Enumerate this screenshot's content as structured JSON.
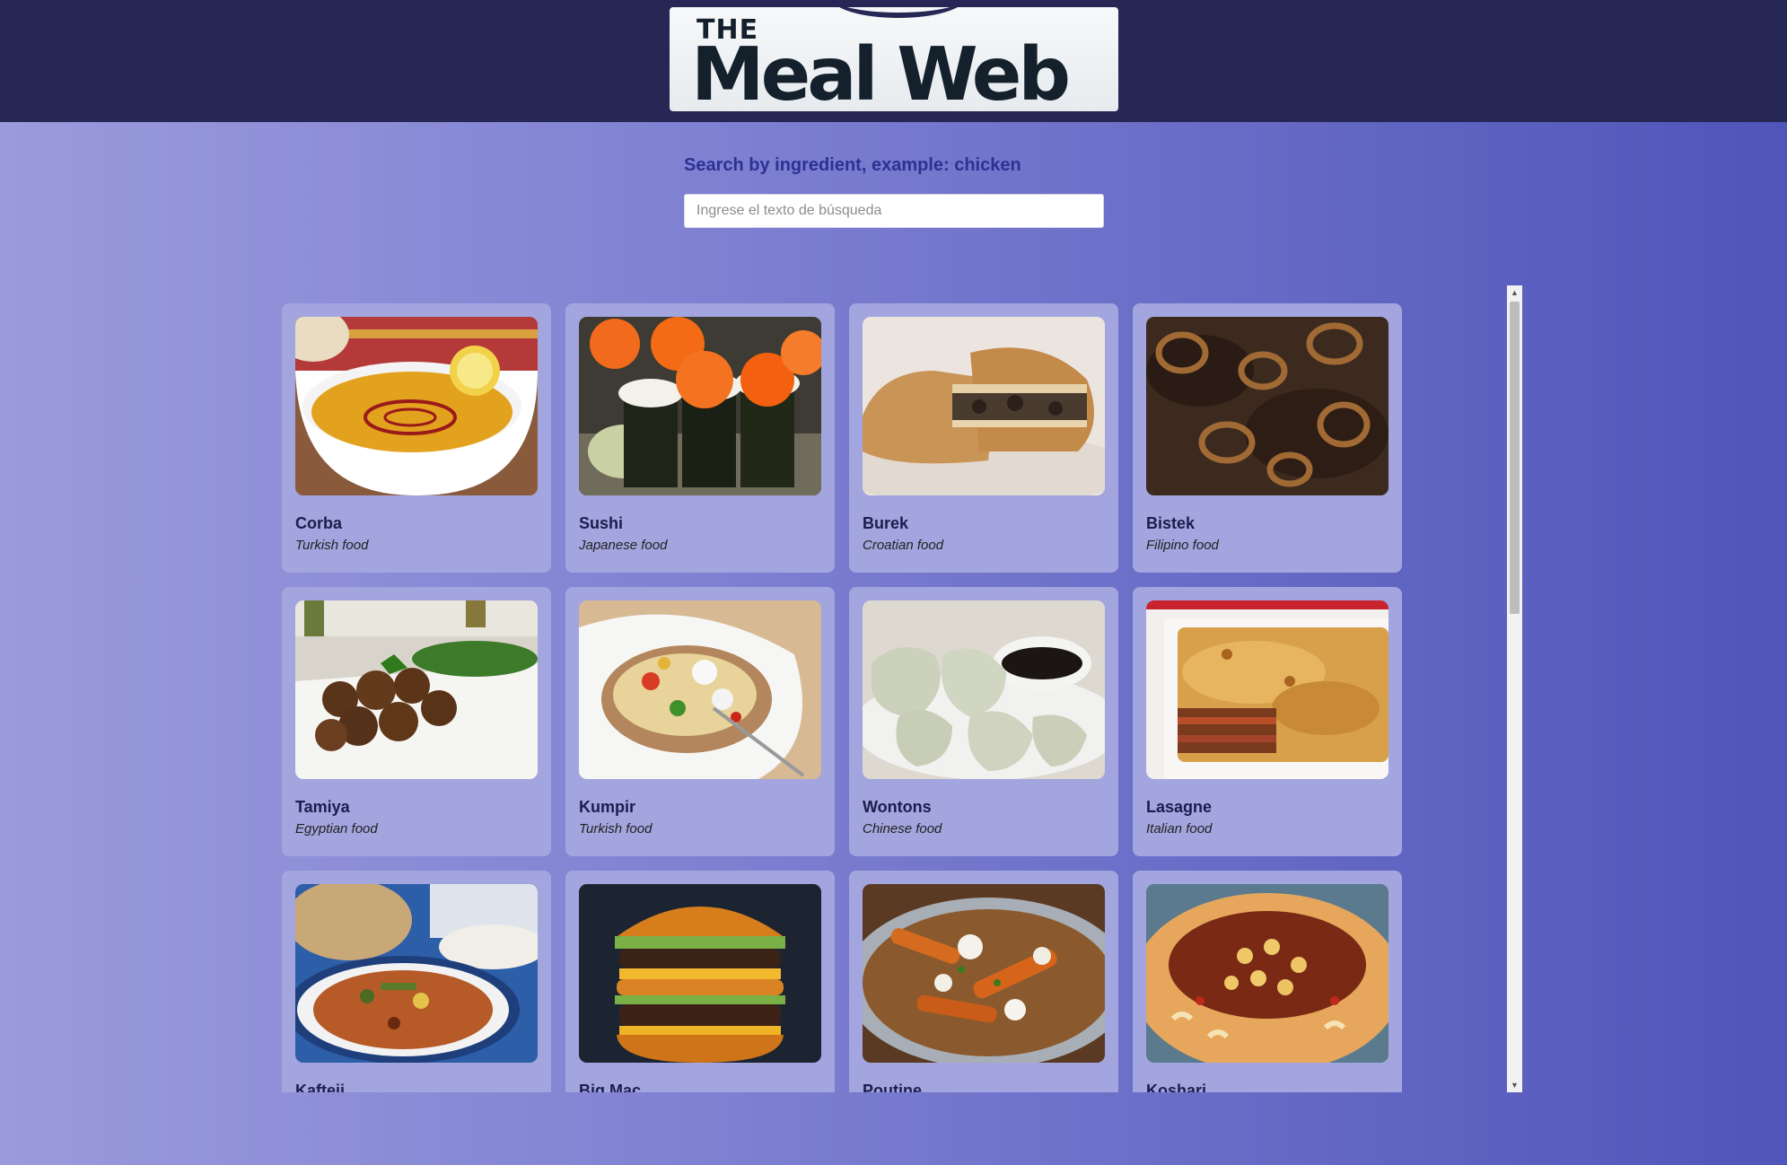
{
  "header": {
    "logo_small": "THE",
    "logo_main": "Meal Web"
  },
  "search": {
    "label": "Search by ingredient, example: chicken",
    "placeholder": "Ingrese el texto de búsqueda",
    "value": ""
  },
  "meals": [
    {
      "name": "Corba",
      "origin": "Turkish food"
    },
    {
      "name": "Sushi",
      "origin": "Japanese food"
    },
    {
      "name": "Burek",
      "origin": "Croatian food"
    },
    {
      "name": "Bistek",
      "origin": "Filipino food"
    },
    {
      "name": "Tamiya",
      "origin": "Egyptian food"
    },
    {
      "name": "Kumpir",
      "origin": "Turkish food"
    },
    {
      "name": "Wontons",
      "origin": "Chinese food"
    },
    {
      "name": "Lasagne",
      "origin": "Italian food"
    },
    {
      "name": "Kafteji",
      "origin": ""
    },
    {
      "name": "Big Mac",
      "origin": ""
    },
    {
      "name": "Poutine",
      "origin": ""
    },
    {
      "name": "Koshari",
      "origin": ""
    }
  ],
  "colors": {
    "header_bg": "#262755",
    "card_bg": "#a2a5de",
    "label_color": "#2d3191"
  }
}
